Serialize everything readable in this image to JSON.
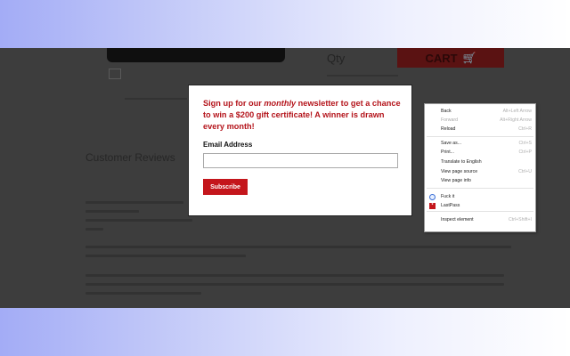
{
  "background_page": {
    "qty_label": "Qty",
    "cart_button_label": "CART",
    "review_heading": "Customer Reviews"
  },
  "modal": {
    "heading_prefix": "Sign up for our ",
    "heading_emphasis": "monthly",
    "heading_suffix": " newsletter to get a chance to win a $200 gift certificate! A winner is drawn every month!",
    "email_label": "Email Address",
    "email_value": "",
    "subscribe_label": "Subscribe"
  },
  "context_menu": {
    "items": [
      {
        "label": "Back",
        "shortcut": "Alt+Left Arrow",
        "disabled": false
      },
      {
        "label": "Forward",
        "shortcut": "Alt+Right Arrow",
        "disabled": true
      },
      {
        "label": "Reload",
        "shortcut": "Ctrl+R",
        "disabled": false
      },
      {
        "label": "Save as...",
        "shortcut": "Ctrl+S",
        "disabled": false
      },
      {
        "label": "Print...",
        "shortcut": "Ctrl+P",
        "disabled": false
      },
      {
        "label": "Translate to English",
        "shortcut": "",
        "disabled": false
      },
      {
        "label": "View page source",
        "shortcut": "Ctrl+U",
        "disabled": false
      },
      {
        "label": "View page info",
        "shortcut": "",
        "disabled": false
      },
      {
        "label": "Fuck it",
        "shortcut": "",
        "disabled": false,
        "icon": "globe-icon"
      },
      {
        "label": "LastPass",
        "shortcut": "",
        "disabled": false,
        "icon": "lastpass-icon"
      },
      {
        "label": "Inspect element",
        "shortcut": "Ctrl+Shift+I",
        "disabled": false
      }
    ]
  },
  "colors": {
    "accent_red": "#c4161c",
    "heading_red": "#b4141b",
    "overlay": "#3d3d3d"
  }
}
